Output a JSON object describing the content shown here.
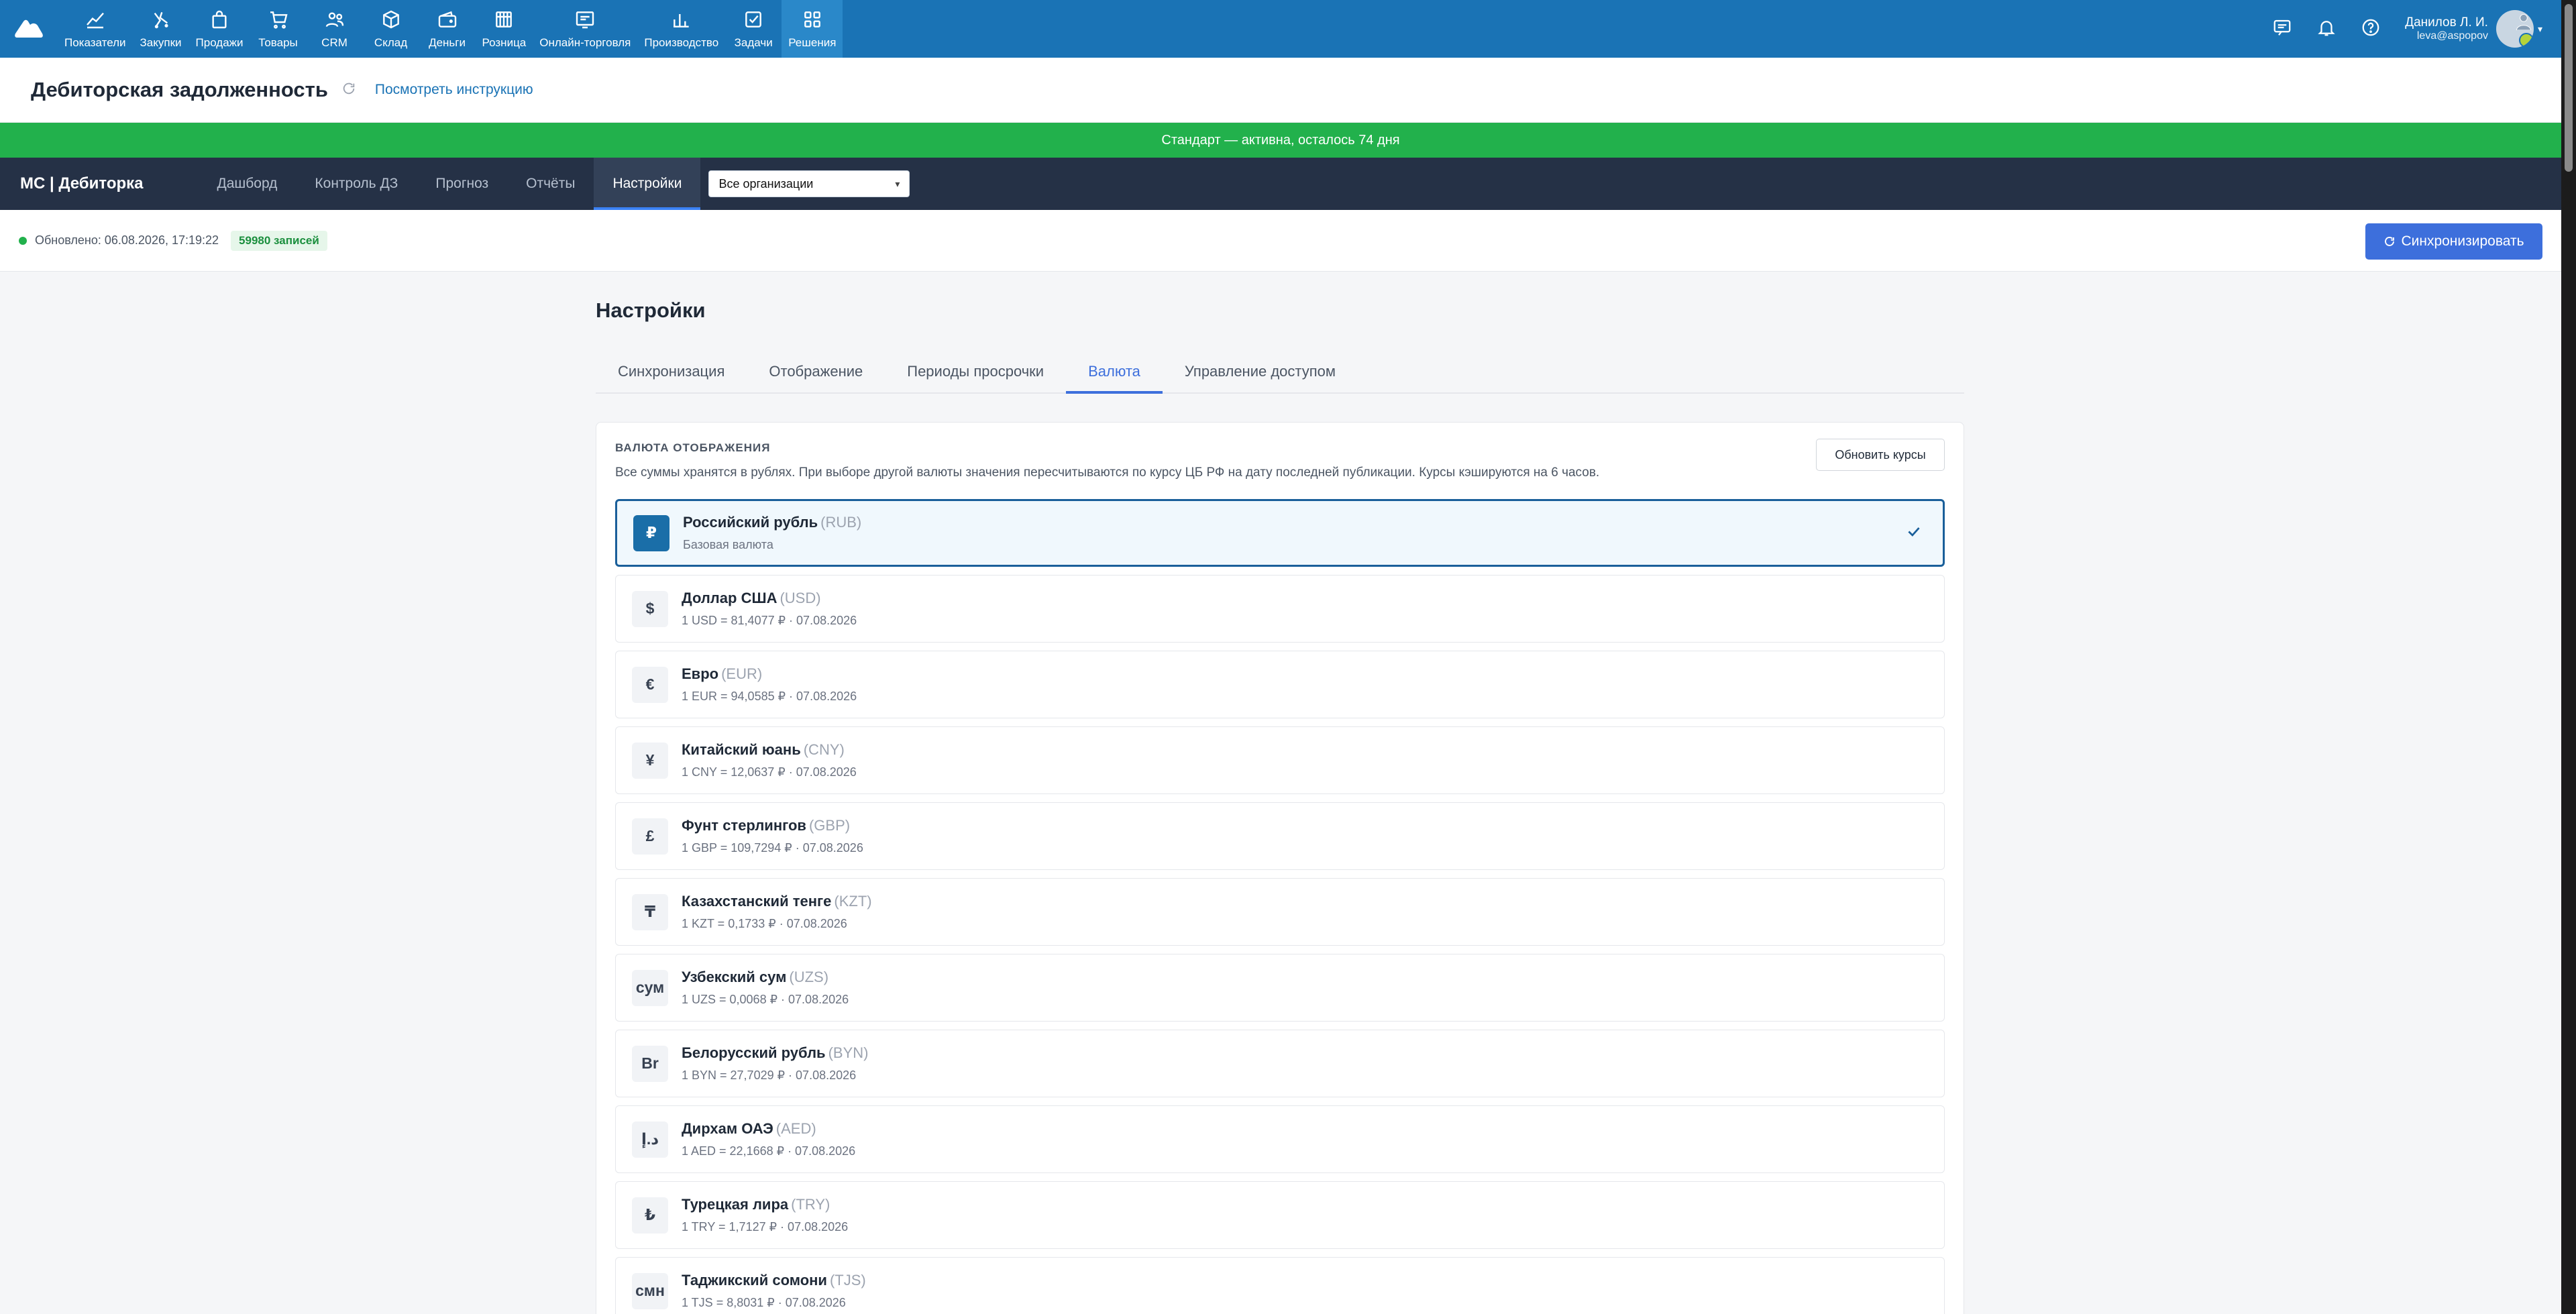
{
  "topnav": {
    "items": [
      {
        "label": "Показатели",
        "icon": "chart-line-icon"
      },
      {
        "label": "Закупки",
        "icon": "purchases-icon"
      },
      {
        "label": "Продажи",
        "icon": "bag-icon"
      },
      {
        "label": "Товары",
        "icon": "cart-icon"
      },
      {
        "label": "CRM",
        "icon": "users-icon"
      },
      {
        "label": "Склад",
        "icon": "box-icon"
      },
      {
        "label": "Деньги",
        "icon": "wallet-icon"
      },
      {
        "label": "Розница",
        "icon": "store-icon"
      },
      {
        "label": "Онлайн-торговля",
        "icon": "online-store-icon"
      },
      {
        "label": "Производство",
        "icon": "bar-chart-icon"
      },
      {
        "label": "Задачи",
        "icon": "checkbox-icon"
      },
      {
        "label": "Решения",
        "icon": "grid-icon"
      }
    ],
    "active_index": 11,
    "user_name": "Данилов Л. И.",
    "user_login": "leva@aspopov"
  },
  "header": {
    "title": "Дебиторская задолженность",
    "instruction_link": "Посмотреть инструкцию"
  },
  "banner": "Стандарт — активна, осталось 74 дня",
  "appbar": {
    "app_name": "МС | Дебиторка",
    "tabs": [
      "Дашборд",
      "Контроль ДЗ",
      "Прогноз",
      "Отчёты",
      "Настройки"
    ],
    "active_tab": "Настройки",
    "org_select": "Все организации"
  },
  "status": {
    "updated": "Обновлено: 06.08.2026, 17:19:22",
    "records": "59980 записей",
    "sync_button": "Синхронизировать"
  },
  "settings": {
    "title": "Настройки",
    "tabs": [
      "Синхронизация",
      "Отображение",
      "Периоды просрочки",
      "Валюта",
      "Управление доступом"
    ],
    "active_tab": "Валюта"
  },
  "currency": {
    "label": "ВАЛЮТА ОТОБРАЖЕНИЯ",
    "description": "Все суммы хранятся в рублях. При выборе другой валюты значения пересчитываются по курсу ЦБ РФ на дату последней публикации. Курсы кэшируются на 6 часов.",
    "update_button": "Обновить курсы",
    "items": [
      {
        "symbol": "₽",
        "name": "Российский рубль",
        "code": "(RUB)",
        "rate": "Базовая валюта",
        "selected": true
      },
      {
        "symbol": "$",
        "name": "Доллар США",
        "code": "(USD)",
        "rate": "1 USD = 81,4077 ₽ · 07.08.2026",
        "selected": false
      },
      {
        "symbol": "€",
        "name": "Евро",
        "code": "(EUR)",
        "rate": "1 EUR = 94,0585 ₽ · 07.08.2026",
        "selected": false
      },
      {
        "symbol": "¥",
        "name": "Китайский юань",
        "code": "(CNY)",
        "rate": "1 CNY = 12,0637 ₽ · 07.08.2026",
        "selected": false
      },
      {
        "symbol": "£",
        "name": "Фунт стерлингов",
        "code": "(GBP)",
        "rate": "1 GBP = 109,7294 ₽ · 07.08.2026",
        "selected": false
      },
      {
        "symbol": "₸",
        "name": "Казахстанский тенге",
        "code": "(KZT)",
        "rate": "1 KZT = 0,1733 ₽ · 07.08.2026",
        "selected": false
      },
      {
        "symbol": "сум",
        "name": "Узбекский сум",
        "code": "(UZS)",
        "rate": "1 UZS = 0,0068 ₽ · 07.08.2026",
        "selected": false
      },
      {
        "symbol": "Br",
        "name": "Белорусский рубль",
        "code": "(BYN)",
        "rate": "1 BYN = 27,7029 ₽ · 07.08.2026",
        "selected": false
      },
      {
        "symbol": "د.إ",
        "name": "Дирхам ОАЭ",
        "code": "(AED)",
        "rate": "1 AED = 22,1668 ₽ · 07.08.2026",
        "selected": false
      },
      {
        "symbol": "₺",
        "name": "Турецкая лира",
        "code": "(TRY)",
        "rate": "1 TRY = 1,7127 ₽ · 07.08.2026",
        "selected": false
      },
      {
        "symbol": "смн",
        "name": "Таджикский сомони",
        "code": "(TJS)",
        "rate": "1 TJS = 8,8031 ₽ · 07.08.2026",
        "selected": false
      }
    ]
  }
}
